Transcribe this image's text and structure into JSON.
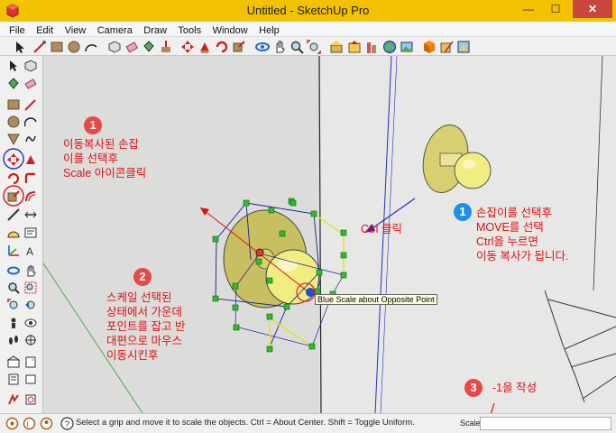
{
  "window": {
    "title": "Untitled - SketchUp Pro",
    "minimize": "—",
    "maximize": "☐",
    "close": "✕"
  },
  "menu": [
    "File",
    "Edit",
    "View",
    "Camera",
    "Draw",
    "Tools",
    "Window",
    "Help"
  ],
  "tooltip": "Blue Scale about Opposite Point",
  "viewport_labels": {
    "ctrl_click": "Ctrl 클릭"
  },
  "annotations": {
    "step1_left": {
      "badge": "1",
      "text": "이동복사된 손잡\n이를 선택후\nScale 아이콘클릭"
    },
    "step1_right": {
      "badge": "1",
      "text": "손잡이를 선택후\nMOVE를 선택\nCtrl을 누르면\n이동 복사가 됩니다."
    },
    "step2": {
      "badge": "2",
      "text": "스케일 선택된\n상태에서 가운데\n포인트를 잡고 반\n대편으로 마우스\n이동시킨후"
    },
    "step3": {
      "badge": "3",
      "text": "-1을 작성"
    }
  },
  "status": {
    "hint": "Select a grip and move it to scale the objects. Ctrl = About Center. Shift = Toggle Uniform.",
    "measurement_label": "Scale",
    "measurement_value": ""
  },
  "colors": {
    "titlebar": "#f2c200",
    "annotation_red": "#e01010",
    "badge_red": "#e84848",
    "badge_blue": "#1e90e0",
    "knob_yellow": "#f0ee80"
  },
  "toolbar_icons": [
    "select-icon",
    "line-icon",
    "rectangle-icon",
    "circle-icon",
    "arc-icon",
    "make-component-icon",
    "eraser-icon",
    "paint-bucket-icon",
    "push-pull-icon",
    "move-icon",
    "rotate-icon",
    "scale-icon",
    "offset-icon",
    "orbit-icon",
    "pan-icon",
    "zoom-icon",
    "zoom-extents-icon",
    "3d-warehouse-icon",
    "share-model-icon",
    "extension-warehouse-icon",
    "google-earth-icon",
    "photo-textures-icon",
    "layout-icon",
    "style-builder-icon"
  ],
  "left_tool_icons": [
    "select-icon",
    "make-component-icon",
    "paint-bucket-icon",
    "eraser-icon",
    "rectangle-icon",
    "line-icon",
    "circle-icon",
    "arc-icon",
    "polygon-icon",
    "freehand-icon",
    "move-icon",
    "push-pull-icon",
    "rotate-icon",
    "follow-me-icon",
    "scale-icon",
    "offset-icon",
    "tape-measure-icon",
    "dimension-icon",
    "protractor-icon",
    "text-icon",
    "axes-icon",
    "3d-text-icon",
    "orbit-icon",
    "pan-icon",
    "zoom-icon",
    "zoom-window-icon",
    "zoom-extents-icon",
    "previous-view-icon",
    "position-camera-icon",
    "look-around-icon",
    "walk-icon",
    "section-plane-icon",
    "3d-warehouse-icon",
    "share-icon",
    "extension-warehouse-icon",
    "layout-icon",
    "sandbox-icon",
    "photo-textures-icon"
  ]
}
